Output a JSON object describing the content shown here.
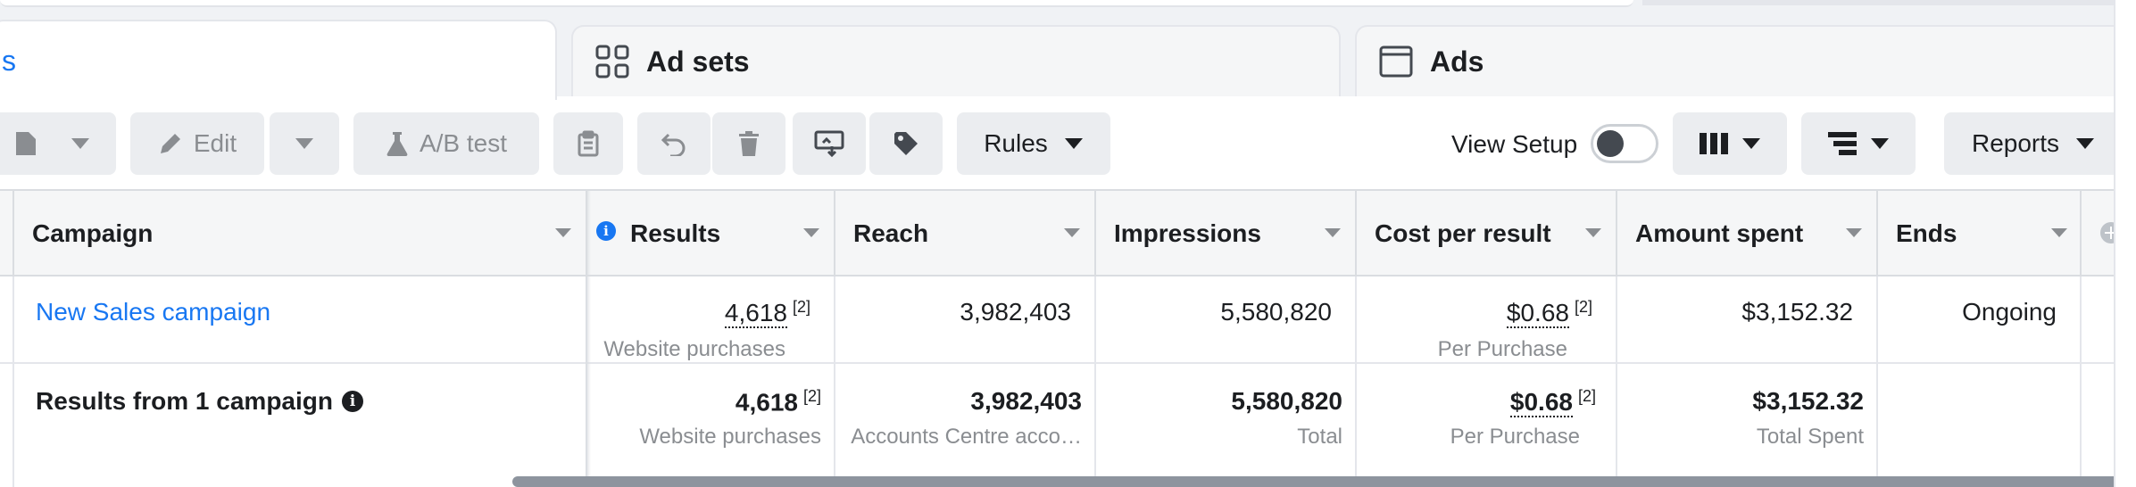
{
  "tabs": [
    {
      "label": "s",
      "icon": "campaigns-icon",
      "active": true
    },
    {
      "label": "Ad sets",
      "icon": "ad-sets-grid-icon",
      "active": false
    },
    {
      "label": "Ads",
      "icon": "ads-window-icon",
      "active": false
    }
  ],
  "toolbar": {
    "edit_label": "Edit",
    "ab_test_label": "A/B test",
    "rules_label": "Rules",
    "view_setup_label": "View Setup",
    "view_setup_on": false,
    "reports_label": "Reports"
  },
  "table": {
    "columns": [
      {
        "label": "Campaign"
      },
      {
        "label": "Results",
        "info": true
      },
      {
        "label": "Reach"
      },
      {
        "label": "Impressions"
      },
      {
        "label": "Cost per result"
      },
      {
        "label": "Amount spent"
      },
      {
        "label": "Ends"
      }
    ],
    "rows": [
      {
        "campaign": "New Sales campaign",
        "results": "4,618",
        "results_note": "[2]",
        "results_sub": "Website purchases",
        "reach": "3,982,403",
        "impressions": "5,580,820",
        "cost_per_result": "$0.68",
        "cost_note": "[2]",
        "cost_sub": "Per Purchase",
        "amount_spent": "$3,152.32",
        "ends": "Ongoing"
      }
    ],
    "totals": {
      "label": "Results from 1 campaign",
      "results": "4,618",
      "results_note": "[2]",
      "results_sub": "Website purchases",
      "reach": "3,982,403",
      "reach_sub": "Accounts Centre acco…",
      "impressions": "5,580,820",
      "impressions_sub": "Total",
      "cost_per_result": "$0.68",
      "cost_note": "[2]",
      "cost_sub": "Per Purchase",
      "amount_spent": "$3,152.32",
      "amount_sub": "Total Spent"
    }
  },
  "colors": {
    "accent": "#1877f2",
    "text": "#1c1e21",
    "muted": "#8a8d91",
    "button_bg": "#ebedf0"
  }
}
